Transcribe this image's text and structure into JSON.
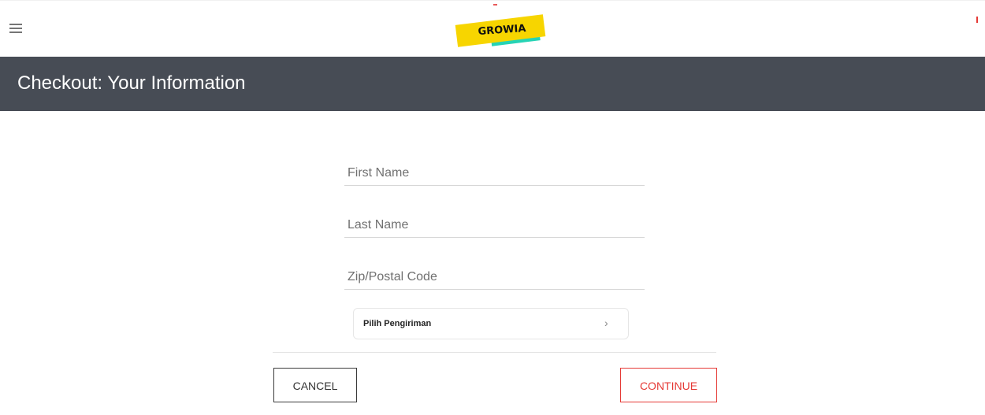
{
  "brand": {
    "logo_text": "GROWIA"
  },
  "header": {
    "title": "Checkout: Your Information"
  },
  "form": {
    "first_name": {
      "value": "",
      "placeholder": "First Name"
    },
    "last_name": {
      "value": "",
      "placeholder": "Last Name"
    },
    "zip": {
      "value": "",
      "placeholder": "Zip/Postal Code"
    },
    "shipping_select": {
      "label": "Pilih Pengiriman",
      "chevron": "›"
    }
  },
  "actions": {
    "cancel_label": "CANCEL",
    "continue_label": "CONTINUE"
  },
  "icons": {
    "menu": "hamburger-menu-icon",
    "chevron": "chevron-right-icon"
  },
  "colors": {
    "header_band": "#474c55",
    "continue_accent": "#e53935",
    "logo_yellow": "#f7d500",
    "logo_teal": "#26d3b5"
  }
}
